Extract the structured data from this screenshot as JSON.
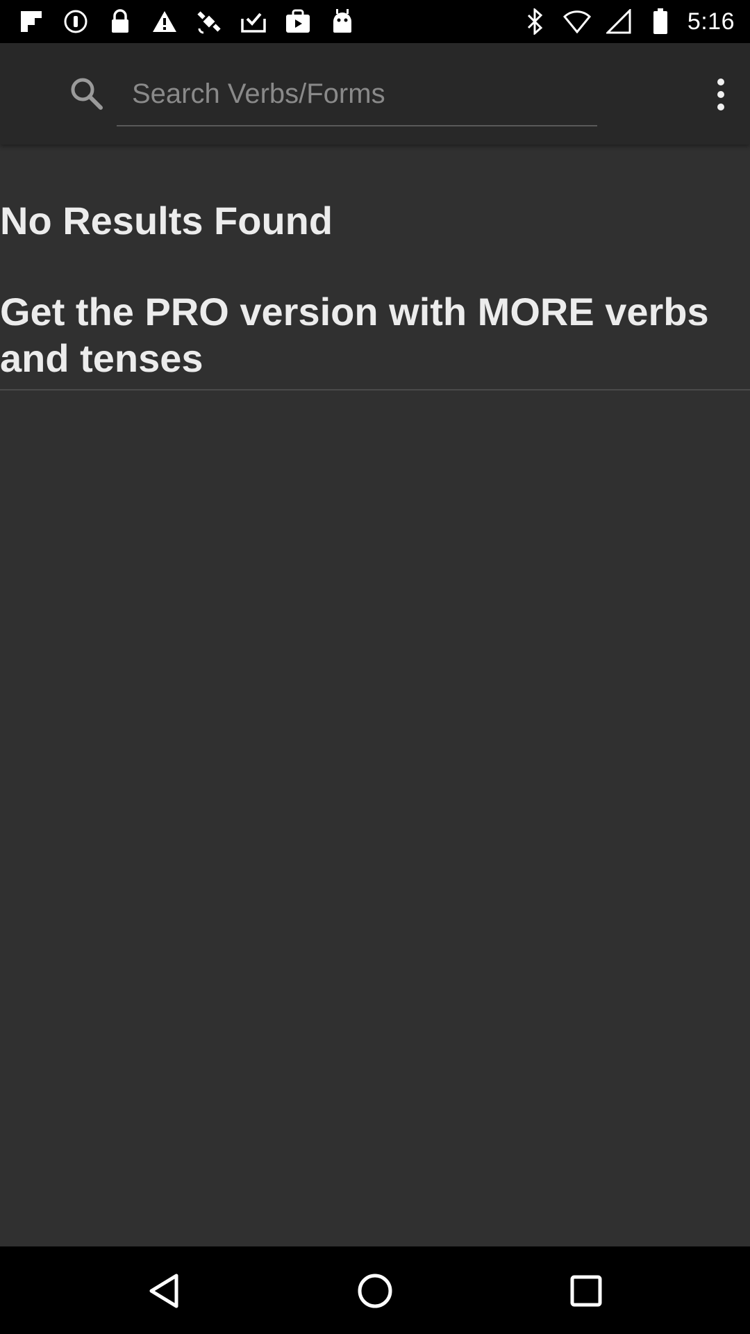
{
  "status_bar": {
    "time": "5:16",
    "icons": [
      "flipboard-icon",
      "notification-circle-icon",
      "lock-icon",
      "warning-icon",
      "fake-gps-icon",
      "download-done-icon",
      "play-store-icon",
      "android-icon",
      "bluetooth-icon",
      "wifi-off-icon",
      "signal-icon",
      "battery-icon"
    ]
  },
  "app_bar": {
    "search_placeholder": "Search Verbs/Forms",
    "search_value": ""
  },
  "results": {
    "no_results_label": "No Results Found",
    "pro_message": "Get the PRO version with MORE verbs and tenses"
  },
  "colors": {
    "background": "#303030",
    "app_bar": "#282828",
    "text": "#ececec",
    "placeholder": "#8a8a8a"
  }
}
